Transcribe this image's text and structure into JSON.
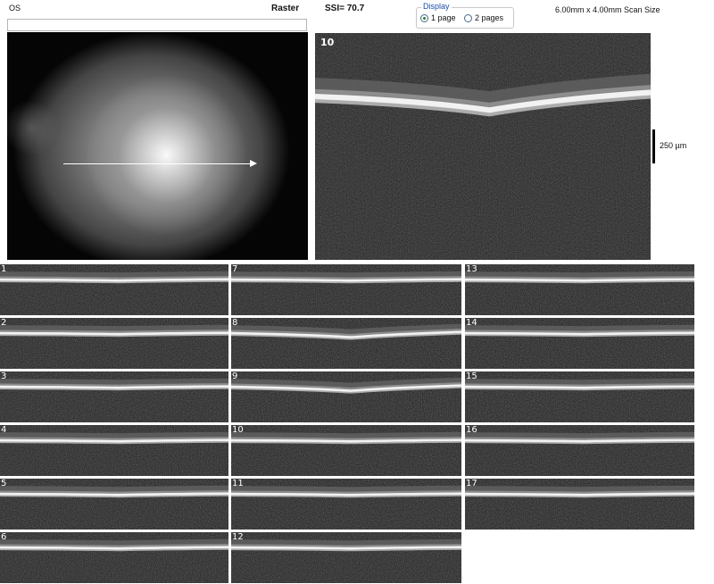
{
  "header": {
    "eye": "OS",
    "scan_type": "Raster",
    "ssi": "SSI= 70.7",
    "scan_size": "6.00mm x 4.00mm Scan Size"
  },
  "display": {
    "legend": "Display",
    "options": [
      {
        "label": "1 page",
        "selected": true
      },
      {
        "label": "2 pages",
        "selected": false
      }
    ]
  },
  "main_bscan": {
    "number": "10"
  },
  "scale": {
    "label": "250 µm"
  },
  "thumbnails": [
    {
      "number": "1"
    },
    {
      "number": "2"
    },
    {
      "number": "3"
    },
    {
      "number": "4"
    },
    {
      "number": "5"
    },
    {
      "number": "6"
    },
    {
      "number": "7"
    },
    {
      "number": "8"
    },
    {
      "number": "9"
    },
    {
      "number": "10"
    },
    {
      "number": "11"
    },
    {
      "number": "12"
    },
    {
      "number": "13"
    },
    {
      "number": "14"
    },
    {
      "number": "15"
    },
    {
      "number": "16"
    },
    {
      "number": "17"
    }
  ]
}
